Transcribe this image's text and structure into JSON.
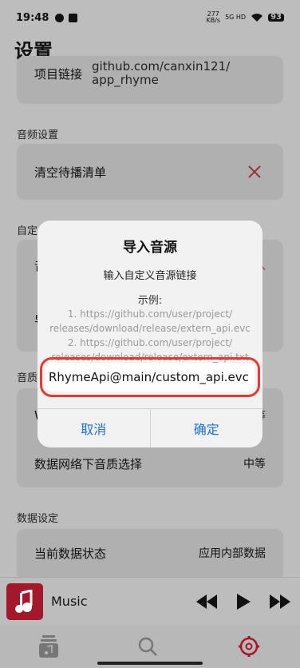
{
  "status": {
    "time": "19:48",
    "net_speed_top": "277",
    "net_speed_bottom": "KB/s",
    "network": "5G HD",
    "battery": "93"
  },
  "page_title": "设置",
  "project": {
    "label": "项目链接",
    "value_line1": "github.com/canxin121/",
    "value_line2": "app_rhyme"
  },
  "audio_section": {
    "title": "音频设置",
    "clear_queue": "清空待播清单"
  },
  "custom_section": {
    "title": "自定",
    "row1_start": "音",
    "row1_end": "入",
    "row2_start": "导"
  },
  "quality_section": {
    "title": "音质",
    "row1_start": "W",
    "row1_end": "等",
    "mobile_label": "数据网络下音质选择",
    "mobile_value": "中等"
  },
  "data_section": {
    "title": "数据设定",
    "state_label": "当前数据状态",
    "state_value": "应用内部数据"
  },
  "dialog": {
    "title": "导入音源",
    "subtitle": "输入自定义音源链接",
    "example_label": "示例:",
    "ex1_line1": "1. https://github.com/user/project/",
    "ex1_line2": "releases/download/release/extern_api.evc",
    "ex2_line1": "2. https://github.com/user/project/",
    "ex2_line2": "releases/download/release/extern_api.txt",
    "input_value": "RhymeApi@main/custom_api.evc",
    "cancel": "取消",
    "confirm": "确定"
  },
  "player": {
    "title": "Music",
    "accent": "#a3182b"
  },
  "nav": {
    "items": [
      "library-icon",
      "search-icon",
      "settings-icon"
    ],
    "active_color": "#a3182b"
  }
}
